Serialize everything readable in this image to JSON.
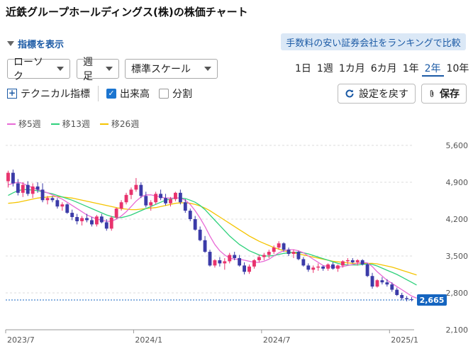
{
  "page_title": "近鉄グループホールディングス(株)の株価チャート",
  "indicator_toggle": "指標を表示",
  "compare_link": "手数料の安い証券会社をランキングで比較",
  "selects": {
    "chart_type": "ローソク",
    "interval": "週足",
    "scale": "標準スケール"
  },
  "periods": [
    "1日",
    "1週",
    "1カ月",
    "6カ月",
    "1年",
    "2年",
    "10年"
  ],
  "active_period": "2年",
  "tools": {
    "technical": "テクニカル指標",
    "volume": "出来高",
    "split": "分割",
    "reset": "設定を戻す",
    "save": "保存"
  },
  "colors": {
    "accent": "#1b5aa5",
    "up": "#e8336d",
    "down": "#3b3ba8",
    "ma5": "#e86ad6",
    "ma13": "#2fd17c",
    "ma26": "#f5c400",
    "price_tag": "#1565c0"
  },
  "chart_data": {
    "type": "candlestick",
    "legend": [
      {
        "label": "移5週",
        "color": "#e86ad6"
      },
      {
        "label": "移13週",
        "color": "#2fd17c"
      },
      {
        "label": "移26週",
        "color": "#f5c400"
      }
    ],
    "y_ticks": [
      "5,600",
      "4,900",
      "4,200",
      "3,500",
      "2,800",
      "2,100"
    ],
    "x_ticks": [
      "2023/7",
      "2024/1",
      "2024/7",
      "2025/1"
    ],
    "ylim": [
      2100,
      5600
    ],
    "last_price": "2,665",
    "last_price_value": 2665,
    "candles": [
      [
        4920,
        5120,
        4800,
        5080
      ],
      [
        5080,
        5140,
        4820,
        4880
      ],
      [
        4880,
        4960,
        4650,
        4700
      ],
      [
        4700,
        4900,
        4620,
        4850
      ],
      [
        4850,
        4920,
        4640,
        4680
      ],
      [
        4680,
        4880,
        4600,
        4820
      ],
      [
        4820,
        4900,
        4700,
        4760
      ],
      [
        4760,
        4880,
        4520,
        4560
      ],
      [
        4560,
        4640,
        4480,
        4600
      ],
      [
        4600,
        4640,
        4520,
        4560
      ],
      [
        4560,
        4600,
        4400,
        4440
      ],
      [
        4440,
        4520,
        4360,
        4480
      ],
      [
        4480,
        4500,
        4300,
        4320
      ],
      [
        4320,
        4380,
        4180,
        4240
      ],
      [
        4240,
        4300,
        4100,
        4160
      ],
      [
        4160,
        4260,
        4080,
        4220
      ],
      [
        4220,
        4300,
        4140,
        4180
      ],
      [
        4180,
        4240,
        4060,
        4100
      ],
      [
        4100,
        4280,
        4060,
        4250
      ],
      [
        4250,
        4300,
        4120,
        4140
      ],
      [
        4140,
        4200,
        3980,
        4020
      ],
      [
        4020,
        4260,
        3980,
        4230
      ],
      [
        4230,
        4420,
        4200,
        4400
      ],
      [
        4400,
        4560,
        4360,
        4520
      ],
      [
        4520,
        4700,
        4480,
        4660
      ],
      [
        4660,
        4800,
        4580,
        4760
      ],
      [
        4760,
        4980,
        4720,
        4850
      ],
      [
        4850,
        4900,
        4600,
        4640
      ],
      [
        4640,
        4720,
        4420,
        4460
      ],
      [
        4460,
        4560,
        4360,
        4520
      ],
      [
        4520,
        4720,
        4480,
        4680
      ],
      [
        4680,
        4760,
        4560,
        4600
      ],
      [
        4600,
        4680,
        4460,
        4500
      ],
      [
        4500,
        4620,
        4440,
        4580
      ],
      [
        4580,
        4720,
        4540,
        4700
      ],
      [
        4700,
        4760,
        4480,
        4520
      ],
      [
        4520,
        4580,
        4320,
        4360
      ],
      [
        4360,
        4400,
        4160,
        4200
      ],
      [
        4200,
        4260,
        3980,
        4000
      ],
      [
        4000,
        4060,
        3780,
        3800
      ],
      [
        3800,
        3880,
        3560,
        3580
      ],
      [
        3580,
        3620,
        3300,
        3320
      ],
      [
        3320,
        3440,
        3280,
        3420
      ],
      [
        3420,
        3480,
        3300,
        3360
      ],
      [
        3360,
        3460,
        3240,
        3400
      ],
      [
        3400,
        3560,
        3360,
        3520
      ],
      [
        3520,
        3580,
        3420,
        3460
      ],
      [
        3460,
        3520,
        3300,
        3320
      ],
      [
        3320,
        3380,
        3150,
        3200
      ],
      [
        3200,
        3340,
        3160,
        3300
      ],
      [
        3300,
        3440,
        3260,
        3420
      ],
      [
        3420,
        3520,
        3380,
        3480
      ],
      [
        3480,
        3560,
        3420,
        3520
      ],
      [
        3520,
        3620,
        3460,
        3580
      ],
      [
        3580,
        3700,
        3540,
        3660
      ],
      [
        3660,
        3780,
        3620,
        3740
      ],
      [
        3740,
        3760,
        3580,
        3620
      ],
      [
        3620,
        3660,
        3500,
        3540
      ],
      [
        3540,
        3620,
        3460,
        3580
      ],
      [
        3580,
        3600,
        3420,
        3440
      ],
      [
        3440,
        3480,
        3300,
        3320
      ],
      [
        3320,
        3360,
        3200,
        3240
      ],
      [
        3240,
        3320,
        3180,
        3280
      ],
      [
        3280,
        3360,
        3220,
        3300
      ],
      [
        3300,
        3320,
        3220,
        3260
      ],
      [
        3260,
        3360,
        3220,
        3340
      ],
      [
        3340,
        3380,
        3240,
        3260
      ],
      [
        3260,
        3340,
        3200,
        3320
      ],
      [
        3320,
        3420,
        3280,
        3400
      ],
      [
        3400,
        3460,
        3340,
        3420
      ],
      [
        3420,
        3460,
        3360,
        3380
      ],
      [
        3380,
        3440,
        3320,
        3420
      ],
      [
        3420,
        3440,
        3320,
        3340
      ],
      [
        3340,
        3360,
        3100,
        3120
      ],
      [
        3120,
        3180,
        2880,
        2920
      ],
      [
        2920,
        3060,
        2900,
        3040
      ],
      [
        3040,
        3100,
        2960,
        3000
      ],
      [
        3000,
        3060,
        2920,
        2960
      ],
      [
        2960,
        3000,
        2820,
        2860
      ],
      [
        2860,
        2900,
        2740,
        2760
      ],
      [
        2760,
        2800,
        2660,
        2700
      ],
      [
        2700,
        2740,
        2640,
        2680
      ],
      [
        2680,
        2720,
        2640,
        2665
      ]
    ],
    "ma5": [
      4850,
      4880,
      4900,
      4880,
      4830,
      4800,
      4760,
      4730,
      4700,
      4660,
      4620,
      4580,
      4520,
      4460,
      4400,
      4340,
      4280,
      4240,
      4200,
      4180,
      4160,
      4160,
      4200,
      4260,
      4340,
      4440,
      4540,
      4620,
      4660,
      4660,
      4640,
      4620,
      4600,
      4600,
      4600,
      4600,
      4560,
      4480,
      4360,
      4220,
      4060,
      3880,
      3720,
      3600,
      3520,
      3460,
      3440,
      3440,
      3420,
      3400,
      3380,
      3380,
      3400,
      3440,
      3500,
      3560,
      3600,
      3620,
      3620,
      3600,
      3560,
      3500,
      3440,
      3380,
      3320,
      3300,
      3290,
      3290,
      3300,
      3320,
      3340,
      3360,
      3380,
      3370,
      3300,
      3200,
      3120,
      3040,
      2980,
      2920,
      2860,
      2800,
      2740,
      2700
    ],
    "ma13": [
      4650,
      4700,
      4740,
      4760,
      4760,
      4750,
      4740,
      4720,
      4700,
      4680,
      4650,
      4620,
      4590,
      4560,
      4520,
      4480,
      4440,
      4400,
      4360,
      4320,
      4280,
      4250,
      4230,
      4230,
      4250,
      4280,
      4320,
      4360,
      4400,
      4440,
      4480,
      4520,
      4560,
      4580,
      4600,
      4600,
      4590,
      4560,
      4520,
      4460,
      4380,
      4280,
      4180,
      4080,
      3980,
      3880,
      3800,
      3720,
      3660,
      3600,
      3560,
      3520,
      3500,
      3500,
      3510,
      3530,
      3550,
      3560,
      3570,
      3570,
      3560,
      3540,
      3510,
      3480,
      3450,
      3420,
      3390,
      3360,
      3340,
      3330,
      3330,
      3330,
      3340,
      3350,
      3340,
      3310,
      3270,
      3230,
      3190,
      3150,
      3100,
      3050,
      3000,
      2950
    ],
    "ma26": [
      4500,
      4510,
      4520,
      4540,
      4560,
      4580,
      4600,
      4610,
      4620,
      4630,
      4630,
      4620,
      4610,
      4600,
      4580,
      4560,
      4540,
      4520,
      4500,
      4480,
      4460,
      4440,
      4420,
      4400,
      4390,
      4380,
      4380,
      4390,
      4400,
      4410,
      4420,
      4440,
      4460,
      4480,
      4500,
      4510,
      4510,
      4500,
      4480,
      4450,
      4410,
      4360,
      4300,
      4240,
      4180,
      4120,
      4060,
      4000,
      3940,
      3880,
      3830,
      3780,
      3740,
      3700,
      3660,
      3630,
      3600,
      3580,
      3560,
      3540,
      3520,
      3500,
      3480,
      3460,
      3440,
      3420,
      3400,
      3390,
      3380,
      3370,
      3360,
      3360,
      3360,
      3360,
      3360,
      3350,
      3330,
      3310,
      3290,
      3260,
      3230,
      3200,
      3170,
      3140
    ]
  }
}
